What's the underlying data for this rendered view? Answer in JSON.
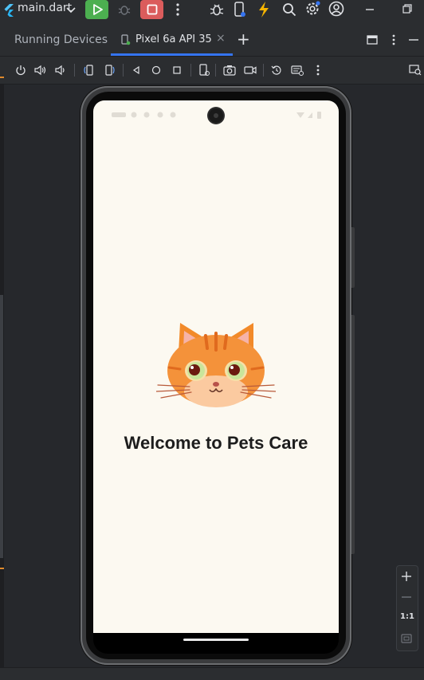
{
  "toolbar": {
    "run_config": "main.dart"
  },
  "tool_window": {
    "title": "Running Devices",
    "tab_label": "Pixel 6a API 35",
    "tab_close": "×",
    "add_tab": "+"
  },
  "app": {
    "welcome_text": "Welcome to Pets Care"
  },
  "zoom": {
    "fit_label": "1:1"
  },
  "colors": {
    "accent_blue": "#3574f0",
    "run_green": "#4caf50",
    "stop_red": "#db5c5c",
    "screen_bg": "#fcf9f1"
  }
}
